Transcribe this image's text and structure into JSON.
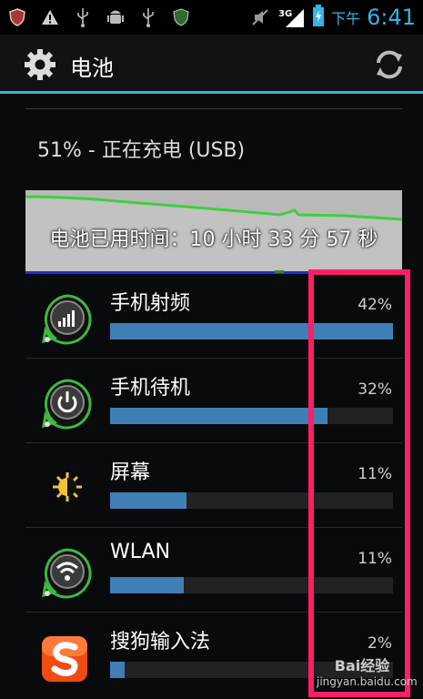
{
  "status_bar": {
    "time_prefix": "下午",
    "time": "6:41",
    "network": "3G",
    "icons": [
      "app-shield-icon",
      "warning-icon",
      "usb-icon",
      "android-debug-icon",
      "usb-icon",
      "security-icon",
      "mute-icon",
      "signal-icon",
      "battery-charging-icon"
    ]
  },
  "action_bar": {
    "title": "电池",
    "settings_icon": "gear-icon",
    "refresh_icon": "refresh-icon"
  },
  "battery": {
    "summary": "51% - 正在充电 (USB)",
    "graph_text": "电池已用时间：10 小时 33 分 57 秒"
  },
  "usage": [
    {
      "label": "手机射频",
      "percent": "42%",
      "fill": 1.0,
      "icon": "cell-signal-icon"
    },
    {
      "label": "手机待机",
      "percent": "32%",
      "fill": 0.77,
      "icon": "power-icon"
    },
    {
      "label": "屏幕",
      "percent": "11%",
      "fill": 0.27,
      "icon": "brightness-icon"
    },
    {
      "label": "WLAN",
      "percent": "11%",
      "fill": 0.26,
      "icon": "wifi-icon"
    },
    {
      "label": "搜狗输入法",
      "percent": "2%",
      "fill": 0.05,
      "icon": "sogou-app-icon"
    }
  ],
  "colors": {
    "accent": "#33b5e5",
    "bar_fill": "#3f7fb5",
    "highlight": "#ff1f65"
  },
  "watermark": {
    "brand": "Bai经验",
    "url": "jingyan.baidu.com"
  }
}
